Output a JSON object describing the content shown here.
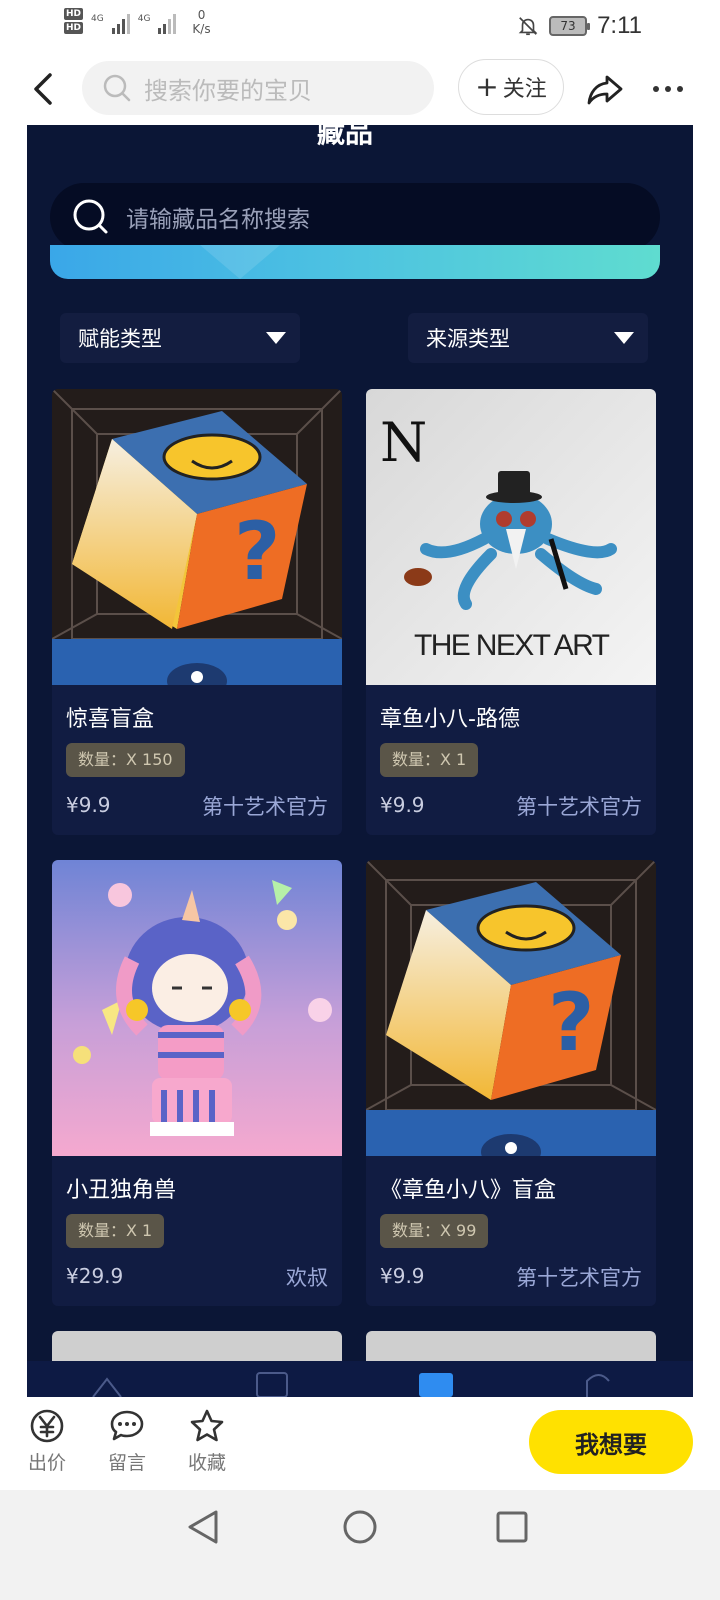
{
  "status_bar": {
    "network_labels": [
      "HD",
      "HD"
    ],
    "signal_labels": [
      "4G",
      "4G"
    ],
    "speed_value": "0",
    "speed_unit": "K/s",
    "battery": "73",
    "time": "7:11"
  },
  "top_nav": {
    "search_placeholder": "搜索你要的宝贝",
    "follow_plus": "+",
    "follow_label": "关注"
  },
  "webview": {
    "partial_title": "藏品",
    "search_placeholder": "请输藏品名称搜索",
    "filters": [
      "赋能类型",
      "来源类型"
    ],
    "items": [
      {
        "name": "惊喜盲盒",
        "quantity": "数量：X 150",
        "price": "¥9.9",
        "seller": "第十艺术官方",
        "art": "mystery-box"
      },
      {
        "name": "章鱼小八-路德",
        "quantity": "数量：X 1",
        "price": "¥9.9",
        "seller": "第十艺术官方",
        "art": "octopus",
        "art_text": "THE NEXT ART",
        "art_logo": "N"
      },
      {
        "name": "小丑独角兽",
        "quantity": "数量：X 1",
        "price": "¥29.9",
        "seller": "欢叔",
        "art": "unicorn"
      },
      {
        "name": "《章鱼小八》盲盒",
        "quantity": "数量：X 99",
        "price": "¥9.9",
        "seller": "第十艺术官方",
        "art": "mystery-box"
      }
    ]
  },
  "action_bar": {
    "bid_label": "出价",
    "comment_label": "留言",
    "favorite_label": "收藏",
    "want_label": "我想要"
  },
  "colors": {
    "page_bg": "#0b1636",
    "card_bg": "#111c42",
    "accent_yellow": "#ffe100"
  }
}
